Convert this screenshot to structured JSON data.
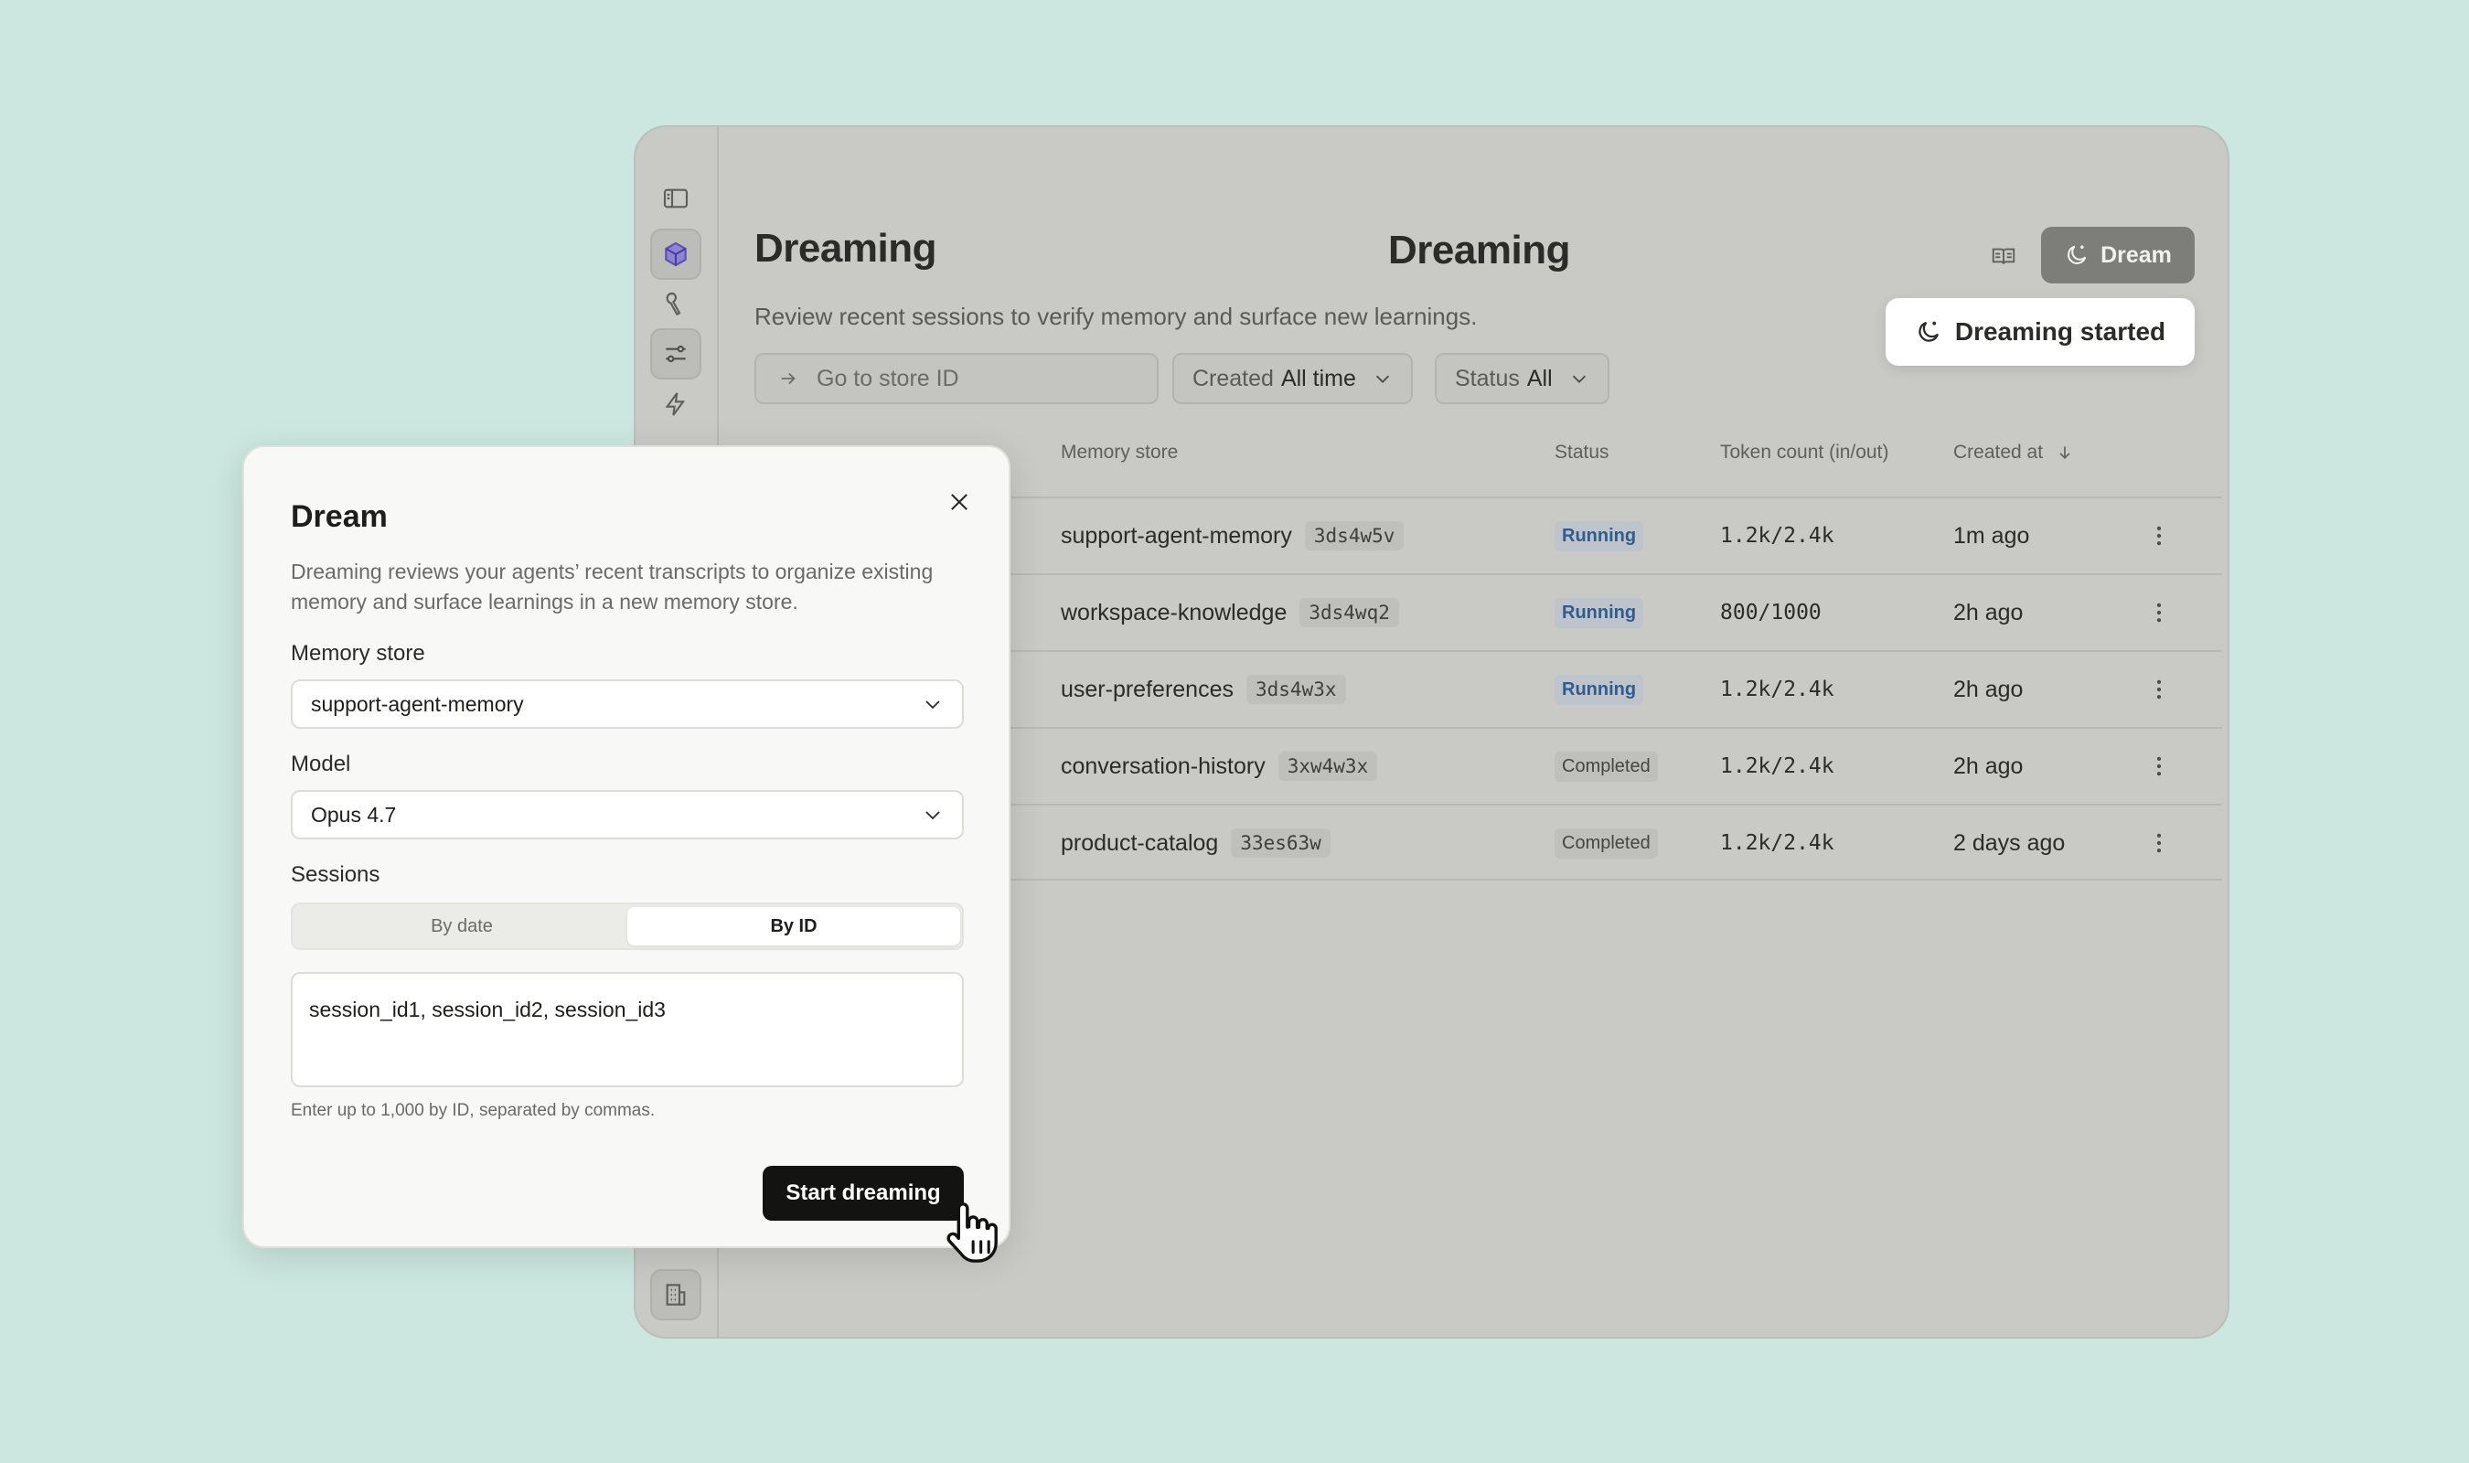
{
  "app": {
    "title": "Dreaming",
    "subtitle": "Review recent sessions to verify memory and surface new learnings.",
    "dream_button_label": "Dream",
    "toast_text": "Dreaming started"
  },
  "filters": {
    "goto_placeholder": "Go to store ID",
    "created": {
      "label": "Created",
      "value": "All time"
    },
    "status": {
      "label": "Status",
      "value": "All"
    }
  },
  "table": {
    "columns": {
      "memory_store": "Memory store",
      "status": "Status",
      "tokens": "Token count (in/out)",
      "created_at": "Created at"
    },
    "rows": [
      {
        "store": "support-agent-memory",
        "id": "3ds4w5v",
        "status": "Running",
        "tokens": "1.2k/2.4k",
        "created": "1m ago"
      },
      {
        "store": "workspace-knowledge",
        "id": "3ds4wq2",
        "status": "Running",
        "tokens": "800/1000",
        "created": "2h ago"
      },
      {
        "store": "user-preferences",
        "id": "3ds4w3x",
        "status": "Running",
        "tokens": "1.2k/2.4k",
        "created": "2h ago"
      },
      {
        "store": "conversation-history",
        "id": "3xw4w3x",
        "status": "Completed",
        "tokens": "1.2k/2.4k",
        "created": "2h ago"
      },
      {
        "store": "product-catalog",
        "id": "33es63w",
        "status": "Completed",
        "tokens": "1.2k/2.4k",
        "created": "2 days ago"
      }
    ]
  },
  "modal": {
    "title": "Dream",
    "description": "Dreaming reviews your agents’ recent transcripts to organize existing memory and surface learnings in a new memory store.",
    "memory_store_label": "Memory store",
    "memory_store_value": "support-agent-memory",
    "model_label": "Model",
    "model_value": "Opus 4.7",
    "sessions_label": "Sessions",
    "tabs": [
      "By date",
      "By ID"
    ],
    "active_tab": "By ID",
    "sessions_value": "session_id1, session_id2, session_id3",
    "helper": "Enter up to 1,000 by ID, separated by commas.",
    "submit_label": "Start dreaming"
  },
  "colors": {
    "background": "#cbe7df",
    "running": "#2f5d8f",
    "primary_button": "#131312"
  }
}
